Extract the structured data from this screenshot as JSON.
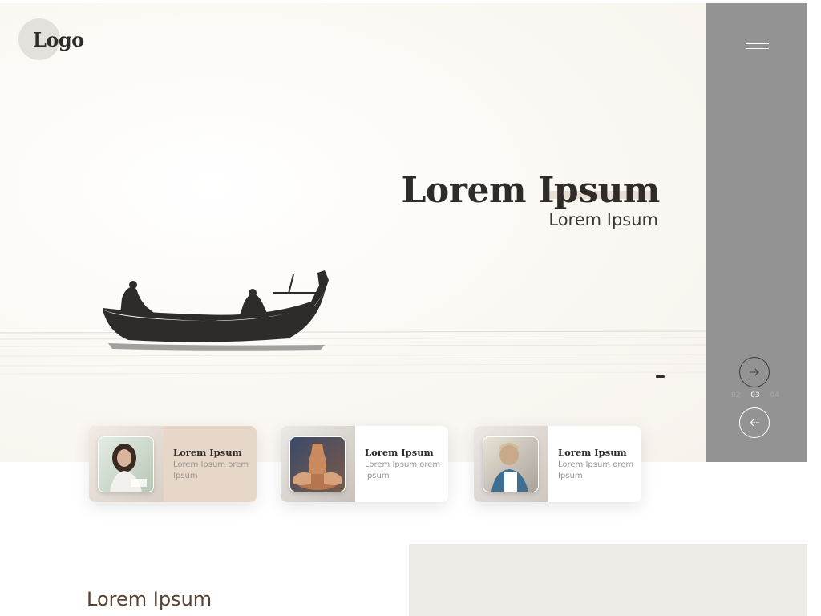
{
  "logo": {
    "text": "Logo"
  },
  "hero": {
    "title": "Lorem Ipsum",
    "subtitle": "Lorem Ipsum"
  },
  "slider": {
    "pages": [
      "02",
      "03",
      "04"
    ],
    "current": "03"
  },
  "cards": [
    {
      "title": "Lorem Ipsum",
      "text": "Lorem Ipsum orem Ipsum",
      "active": true
    },
    {
      "title": "Lorem Ipsum",
      "text": "Lorem Ipsum orem Ipsum",
      "active": false
    },
    {
      "title": "Lorem Ipsum",
      "text": "Lorem Ipsum orem Ipsum",
      "active": false
    }
  ],
  "section": {
    "title": "Lorem Ipsum"
  },
  "colors": {
    "sidebar": "#939393",
    "hero_bg": "#fdfaf6",
    "card_active": "#e6d7c8",
    "text_dark": "#2e2b29",
    "section_title": "#5a4232"
  },
  "icons": {
    "menu": "hamburger-menu-icon",
    "next": "arrow-right-icon",
    "prev": "arrow-left-icon"
  }
}
